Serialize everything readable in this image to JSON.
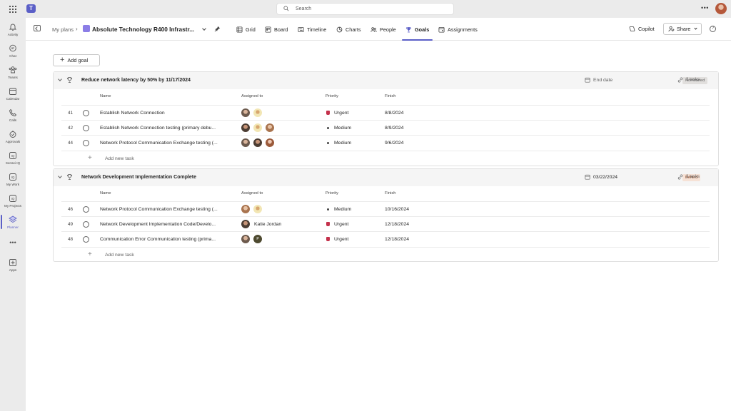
{
  "titlebar": {
    "search_placeholder": "Search",
    "more": "•••"
  },
  "rail": {
    "items": [
      {
        "label": "Activity",
        "icon": "bell-icon"
      },
      {
        "label": "Chat",
        "icon": "chat-icon"
      },
      {
        "label": "Teams",
        "icon": "teams-icon"
      },
      {
        "label": "Calendar",
        "icon": "calendar-icon"
      },
      {
        "label": "Calls",
        "icon": "phone-icon"
      },
      {
        "label": "Approvals",
        "icon": "approvals-icon"
      },
      {
        "label": "Sensei IQ",
        "icon": "iq-icon"
      },
      {
        "label": "My Work",
        "icon": "iq-icon"
      },
      {
        "label": "My Projects",
        "icon": "iq-icon"
      },
      {
        "label": "Planner",
        "icon": "planner-icon"
      }
    ],
    "more": "•••",
    "apps": "Apps"
  },
  "header": {
    "breadcrumb_root": "My plans",
    "plan_name": "Absolute Technology R400 Infrastr...",
    "tabs": [
      {
        "label": "Grid",
        "icon": "grid-icon"
      },
      {
        "label": "Board",
        "icon": "board-icon"
      },
      {
        "label": "Timeline",
        "icon": "timeline-icon"
      },
      {
        "label": "Charts",
        "icon": "charts-icon"
      },
      {
        "label": "People",
        "icon": "people-icon"
      },
      {
        "label": "Goals",
        "icon": "trophy-icon"
      },
      {
        "label": "Assignments",
        "icon": "assignments-icon"
      }
    ],
    "copilot": "Copilot",
    "share": "Share"
  },
  "add_goal": "Add goal",
  "columns": {
    "name": "Name",
    "assigned": "Assigned to",
    "priority": "Priority",
    "finish": "Finish"
  },
  "add_task": "Add new task",
  "goals": [
    {
      "title": "Reduce network latency by 50% by 11/17/2024",
      "date": "End date",
      "status": "Not started",
      "status_color": "#e1dfdd",
      "tasks": "3 tasks",
      "rows": [
        {
          "id": "41",
          "name": "Establish Network Connection",
          "priority": "Urgent",
          "finish": "8/8/2024"
        },
        {
          "id": "42",
          "name": "Establish Network Connection testing (primary debu...",
          "priority": "Medium",
          "finish": "8/9/2024"
        },
        {
          "id": "44",
          "name": "Network Protocol Communication Exchange testing (...",
          "priority": "Medium",
          "finish": "9/6/2024"
        }
      ]
    },
    {
      "title": "Network Development Implementation Complete",
      "date": "03/22/2024",
      "status": "Behind",
      "status_color": "#f6e2d6",
      "tasks": "3 tasks",
      "rows": [
        {
          "id": "46",
          "name": "Network Protocol Communication Exchange testing (...",
          "priority": "Medium",
          "finish": "10/16/2024"
        },
        {
          "id": "49",
          "name": "Network Development Implementation Code/Develo...",
          "assignee": "Katie Jordan",
          "priority": "Urgent",
          "finish": "12/18/2024"
        },
        {
          "id": "48",
          "name": "Communication Error Communication testing (prima...",
          "priority": "Urgent",
          "finish": "12/18/2024",
          "avatar_initial": "P"
        }
      ]
    }
  ],
  "colors": {
    "accent": "#5b5fc7",
    "urgent": "#c4314b"
  }
}
